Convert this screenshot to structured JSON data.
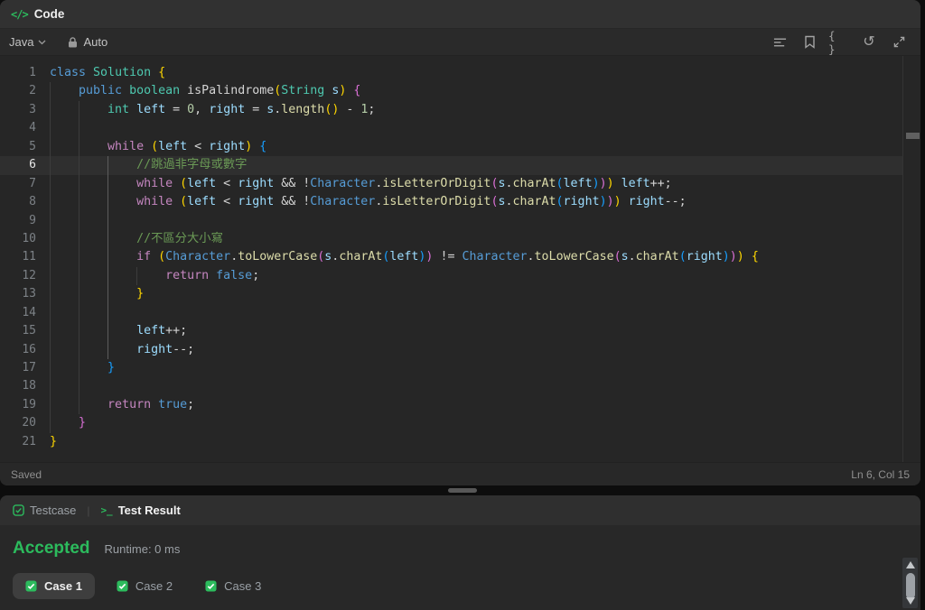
{
  "colors": {
    "green": "#2cbb5d",
    "icon_gray": "#a3a3a3"
  },
  "header": {
    "icon_glyph": "</>",
    "title": "Code"
  },
  "toolbar": {
    "language": "Java",
    "auto_label": "Auto",
    "braces_glyph": "{ }",
    "reset_glyph": "↺",
    "icons": [
      "format-icon",
      "bookmark-icon",
      "braces-icon",
      "reset-icon",
      "expand-icon"
    ]
  },
  "editor": {
    "palette": {
      "kw": "#569cd6",
      "type": "#4ec9b0",
      "ctrl": "#c586c0",
      "var": "#9cdcfe",
      "num": "#b5cea8",
      "fn": "#dcdcaa",
      "fndef": "#d4d4d4",
      "cls": "#569cd6",
      "cm": "#6a9955",
      "pl": "#d4d4d4",
      "b1": "#ffd700",
      "b2": "#da70d6",
      "b3": "#179fff"
    },
    "lines": [
      {
        "n": 1,
        "guides": [],
        "tokens": [
          {
            "t": "class",
            "c": "kw"
          },
          {
            "t": " ",
            "c": "pl"
          },
          {
            "t": "Solution",
            "c": "type"
          },
          {
            "t": " ",
            "c": "pl"
          },
          {
            "t": "{",
            "c": "b1"
          }
        ]
      },
      {
        "n": 2,
        "guides": [
          0
        ],
        "tokens": [
          {
            "t": "    ",
            "c": "pl"
          },
          {
            "t": "public",
            "c": "kw"
          },
          {
            "t": " ",
            "c": "pl"
          },
          {
            "t": "boolean",
            "c": "type"
          },
          {
            "t": " ",
            "c": "pl"
          },
          {
            "t": "isPalindrome",
            "c": "fndef"
          },
          {
            "t": "(",
            "c": "b1"
          },
          {
            "t": "String",
            "c": "type"
          },
          {
            "t": " ",
            "c": "pl"
          },
          {
            "t": "s",
            "c": "var"
          },
          {
            "t": ")",
            "c": "b1"
          },
          {
            "t": " ",
            "c": "pl"
          },
          {
            "t": "{",
            "c": "b2"
          }
        ]
      },
      {
        "n": 3,
        "guides": [
          0,
          4
        ],
        "tokens": [
          {
            "t": "        ",
            "c": "pl"
          },
          {
            "t": "int",
            "c": "type"
          },
          {
            "t": " ",
            "c": "pl"
          },
          {
            "t": "left",
            "c": "var"
          },
          {
            "t": " = ",
            "c": "pl"
          },
          {
            "t": "0",
            "c": "num"
          },
          {
            "t": ", ",
            "c": "pl"
          },
          {
            "t": "right",
            "c": "var"
          },
          {
            "t": " = ",
            "c": "pl"
          },
          {
            "t": "s",
            "c": "var"
          },
          {
            "t": ".",
            "c": "pl"
          },
          {
            "t": "length",
            "c": "fn"
          },
          {
            "t": "()",
            "c": "b1"
          },
          {
            "t": " - ",
            "c": "pl"
          },
          {
            "t": "1",
            "c": "num"
          },
          {
            "t": ";",
            "c": "pl"
          }
        ]
      },
      {
        "n": 4,
        "guides": [
          0,
          4
        ],
        "tokens": []
      },
      {
        "n": 5,
        "guides": [
          0,
          4
        ],
        "tokens": [
          {
            "t": "        ",
            "c": "pl"
          },
          {
            "t": "while",
            "c": "ctrl"
          },
          {
            "t": " ",
            "c": "pl"
          },
          {
            "t": "(",
            "c": "b1"
          },
          {
            "t": "left",
            "c": "var"
          },
          {
            "t": " < ",
            "c": "pl"
          },
          {
            "t": "right",
            "c": "var"
          },
          {
            "t": ")",
            "c": "b1"
          },
          {
            "t": " ",
            "c": "pl"
          },
          {
            "t": "{",
            "c": "b3"
          }
        ]
      },
      {
        "n": 6,
        "active": true,
        "guides": [
          0,
          4,
          8
        ],
        "hl": 8,
        "tokens": [
          {
            "t": "            ",
            "c": "pl"
          },
          {
            "t": "//跳過非字母或數字",
            "c": "cm"
          }
        ]
      },
      {
        "n": 7,
        "guides": [
          0,
          4,
          8
        ],
        "hl": 8,
        "tokens": [
          {
            "t": "            ",
            "c": "pl"
          },
          {
            "t": "while",
            "c": "ctrl"
          },
          {
            "t": " ",
            "c": "pl"
          },
          {
            "t": "(",
            "c": "b1"
          },
          {
            "t": "left",
            "c": "var"
          },
          {
            "t": " < ",
            "c": "pl"
          },
          {
            "t": "right",
            "c": "var"
          },
          {
            "t": " && !",
            "c": "pl"
          },
          {
            "t": "Character",
            "c": "cls"
          },
          {
            "t": ".",
            "c": "pl"
          },
          {
            "t": "isLetterOrDigit",
            "c": "fn"
          },
          {
            "t": "(",
            "c": "b2"
          },
          {
            "t": "s",
            "c": "var"
          },
          {
            "t": ".",
            "c": "pl"
          },
          {
            "t": "charAt",
            "c": "fn"
          },
          {
            "t": "(",
            "c": "b3"
          },
          {
            "t": "left",
            "c": "var"
          },
          {
            "t": ")",
            "c": "b3"
          },
          {
            "t": ")",
            "c": "b2"
          },
          {
            "t": ")",
            "c": "b1"
          },
          {
            "t": " ",
            "c": "pl"
          },
          {
            "t": "left",
            "c": "var"
          },
          {
            "t": "++;",
            "c": "pl"
          }
        ]
      },
      {
        "n": 8,
        "guides": [
          0,
          4,
          8
        ],
        "hl": 8,
        "tokens": [
          {
            "t": "            ",
            "c": "pl"
          },
          {
            "t": "while",
            "c": "ctrl"
          },
          {
            "t": " ",
            "c": "pl"
          },
          {
            "t": "(",
            "c": "b1"
          },
          {
            "t": "left",
            "c": "var"
          },
          {
            "t": " < ",
            "c": "pl"
          },
          {
            "t": "right",
            "c": "var"
          },
          {
            "t": " && !",
            "c": "pl"
          },
          {
            "t": "Character",
            "c": "cls"
          },
          {
            "t": ".",
            "c": "pl"
          },
          {
            "t": "isLetterOrDigit",
            "c": "fn"
          },
          {
            "t": "(",
            "c": "b2"
          },
          {
            "t": "s",
            "c": "var"
          },
          {
            "t": ".",
            "c": "pl"
          },
          {
            "t": "charAt",
            "c": "fn"
          },
          {
            "t": "(",
            "c": "b3"
          },
          {
            "t": "right",
            "c": "var"
          },
          {
            "t": ")",
            "c": "b3"
          },
          {
            "t": ")",
            "c": "b2"
          },
          {
            "t": ")",
            "c": "b1"
          },
          {
            "t": " ",
            "c": "pl"
          },
          {
            "t": "right",
            "c": "var"
          },
          {
            "t": "--;",
            "c": "pl"
          }
        ]
      },
      {
        "n": 9,
        "guides": [
          0,
          4,
          8
        ],
        "hl": 8,
        "tokens": []
      },
      {
        "n": 10,
        "guides": [
          0,
          4,
          8
        ],
        "hl": 8,
        "tokens": [
          {
            "t": "            ",
            "c": "pl"
          },
          {
            "t": "//不區分大小寫",
            "c": "cm"
          }
        ]
      },
      {
        "n": 11,
        "guides": [
          0,
          4,
          8
        ],
        "hl": 8,
        "tokens": [
          {
            "t": "            ",
            "c": "pl"
          },
          {
            "t": "if",
            "c": "ctrl"
          },
          {
            "t": " ",
            "c": "pl"
          },
          {
            "t": "(",
            "c": "b1"
          },
          {
            "t": "Character",
            "c": "cls"
          },
          {
            "t": ".",
            "c": "pl"
          },
          {
            "t": "toLowerCase",
            "c": "fn"
          },
          {
            "t": "(",
            "c": "b2"
          },
          {
            "t": "s",
            "c": "var"
          },
          {
            "t": ".",
            "c": "pl"
          },
          {
            "t": "charAt",
            "c": "fn"
          },
          {
            "t": "(",
            "c": "b3"
          },
          {
            "t": "left",
            "c": "var"
          },
          {
            "t": ")",
            "c": "b3"
          },
          {
            "t": ")",
            "c": "b2"
          },
          {
            "t": " != ",
            "c": "pl"
          },
          {
            "t": "Character",
            "c": "cls"
          },
          {
            "t": ".",
            "c": "pl"
          },
          {
            "t": "toLowerCase",
            "c": "fn"
          },
          {
            "t": "(",
            "c": "b2"
          },
          {
            "t": "s",
            "c": "var"
          },
          {
            "t": ".",
            "c": "pl"
          },
          {
            "t": "charAt",
            "c": "fn"
          },
          {
            "t": "(",
            "c": "b3"
          },
          {
            "t": "right",
            "c": "var"
          },
          {
            "t": ")",
            "c": "b3"
          },
          {
            "t": ")",
            "c": "b2"
          },
          {
            "t": ")",
            "c": "b1"
          },
          {
            "t": " ",
            "c": "pl"
          },
          {
            "t": "{",
            "c": "b1"
          }
        ]
      },
      {
        "n": 12,
        "guides": [
          0,
          4,
          8,
          12
        ],
        "hl": 8,
        "tokens": [
          {
            "t": "                ",
            "c": "pl"
          },
          {
            "t": "return",
            "c": "ctrl"
          },
          {
            "t": " ",
            "c": "pl"
          },
          {
            "t": "false",
            "c": "kw"
          },
          {
            "t": ";",
            "c": "pl"
          }
        ]
      },
      {
        "n": 13,
        "guides": [
          0,
          4,
          8
        ],
        "hl": 8,
        "tokens": [
          {
            "t": "            ",
            "c": "pl"
          },
          {
            "t": "}",
            "c": "b1"
          }
        ]
      },
      {
        "n": 14,
        "guides": [
          0,
          4,
          8
        ],
        "hl": 8,
        "tokens": []
      },
      {
        "n": 15,
        "guides": [
          0,
          4,
          8
        ],
        "hl": 8,
        "tokens": [
          {
            "t": "            ",
            "c": "pl"
          },
          {
            "t": "left",
            "c": "var"
          },
          {
            "t": "++;",
            "c": "pl"
          }
        ]
      },
      {
        "n": 16,
        "guides": [
          0,
          4,
          8
        ],
        "hl": 8,
        "tokens": [
          {
            "t": "            ",
            "c": "pl"
          },
          {
            "t": "right",
            "c": "var"
          },
          {
            "t": "--;",
            "c": "pl"
          }
        ]
      },
      {
        "n": 17,
        "guides": [
          0,
          4
        ],
        "tokens": [
          {
            "t": "        ",
            "c": "pl"
          },
          {
            "t": "}",
            "c": "b3"
          }
        ]
      },
      {
        "n": 18,
        "guides": [
          0,
          4
        ],
        "tokens": []
      },
      {
        "n": 19,
        "guides": [
          0,
          4
        ],
        "tokens": [
          {
            "t": "        ",
            "c": "pl"
          },
          {
            "t": "return",
            "c": "ctrl"
          },
          {
            "t": " ",
            "c": "pl"
          },
          {
            "t": "true",
            "c": "kw"
          },
          {
            "t": ";",
            "c": "pl"
          }
        ]
      },
      {
        "n": 20,
        "guides": [
          0
        ],
        "tokens": [
          {
            "t": "    ",
            "c": "pl"
          },
          {
            "t": "}",
            "c": "b2"
          }
        ]
      },
      {
        "n": 21,
        "guides": [],
        "tokens": [
          {
            "t": "}",
            "c": "b1"
          }
        ]
      }
    ]
  },
  "statusbar": {
    "saved": "Saved",
    "cursor": "Ln 6, Col 15"
  },
  "bottom": {
    "tabs": [
      {
        "label": "Testcase",
        "active": false
      },
      {
        "label": "Test Result",
        "active": true
      }
    ],
    "terminal_glyph": ">_",
    "result": {
      "status": "Accepted",
      "runtime": "Runtime: 0 ms"
    },
    "cases": [
      {
        "label": "Case 1",
        "active": true
      },
      {
        "label": "Case 2",
        "active": false
      },
      {
        "label": "Case 3",
        "active": false
      }
    ],
    "check_glyph": "✓"
  }
}
